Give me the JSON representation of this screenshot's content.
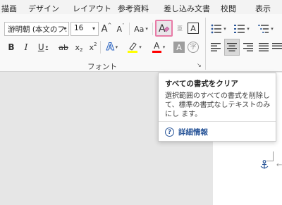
{
  "tabs": [
    "描画",
    "デザイン",
    "レイアウト",
    "参考資料",
    "差し込み文書",
    "校閲",
    "表示"
  ],
  "font": {
    "name": "游明朝 (本文のフ:",
    "size": "16",
    "group_label": "フォント"
  },
  "font_tools": {
    "grow": "A",
    "shrink": "A",
    "change_case": "Aa",
    "clear_format": "A",
    "phonetic": "亜",
    "char_border": "A",
    "bold": "B",
    "italic": "I",
    "underline": "U",
    "strike": "ab",
    "subscript": "x",
    "superscript": "x",
    "text_effects": "A",
    "font_color": "A",
    "char_shading": "A",
    "enclose": "字"
  },
  "colors": {
    "highlight_bar": "#ffff00",
    "font_color_bar": "#ff0000",
    "text_effects_color": "#2b64c2",
    "accent": "#2b579a",
    "selected_border": "#e87aa6"
  },
  "tooltip": {
    "title": "すべての書式をクリア",
    "body": "選択範囲のすべての書式を削除し て、標準の書式なしテキストのみにし ます。",
    "help_label": "詳細情報"
  },
  "icons": {
    "help": "help-circle-icon",
    "anchor": "anchor-icon"
  }
}
